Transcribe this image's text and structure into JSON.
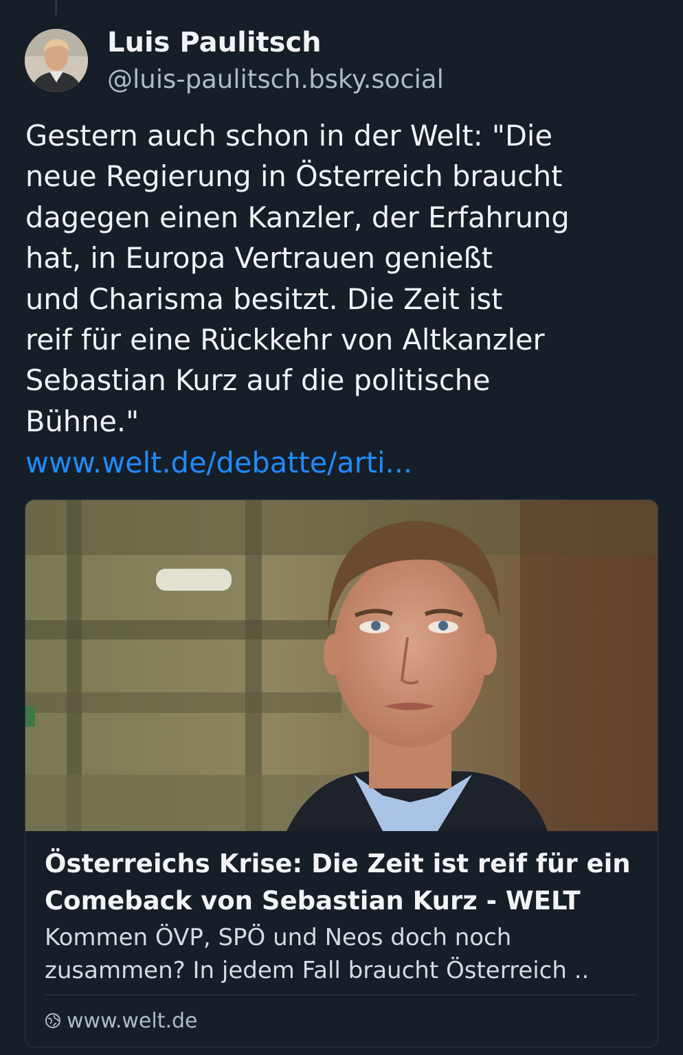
{
  "author": {
    "display_name": "Luis Paulitsch",
    "handle": "@luis-paulitsch.bsky.social"
  },
  "post": {
    "text_lines": [
      "Gestern auch schon in der Welt: \"Die",
      "neue Regierung in Österreich braucht",
      "dagegen einen Kanzler, der Erfahrung",
      "hat, in Europa Vertrauen genießt",
      "und Charisma besitzt. Die Zeit ist",
      "reif für eine Rückkehr von Altkanzler",
      "Sebastian Kurz auf die politische",
      "Bühne.\""
    ],
    "link": "www.welt.de/debatte/arti..."
  },
  "embed": {
    "title_lines": [
      "Österreichs Krise: Die Zeit ist reif für ein",
      "Comeback von Sebastian Kurz - WELT"
    ],
    "description_lines": [
      "Kommen ÖVP, SPÖ und Neos doch noch",
      "zusammen? In jedem Fall braucht Österreich .."
    ],
    "domain": "www.welt.de",
    "domain_icon": "globe-icon"
  },
  "colors": {
    "background": "#161e27",
    "text": "#f1f3f5",
    "muted": "#aebbc9",
    "link": "#208bfe",
    "border": "#2e3a47"
  }
}
